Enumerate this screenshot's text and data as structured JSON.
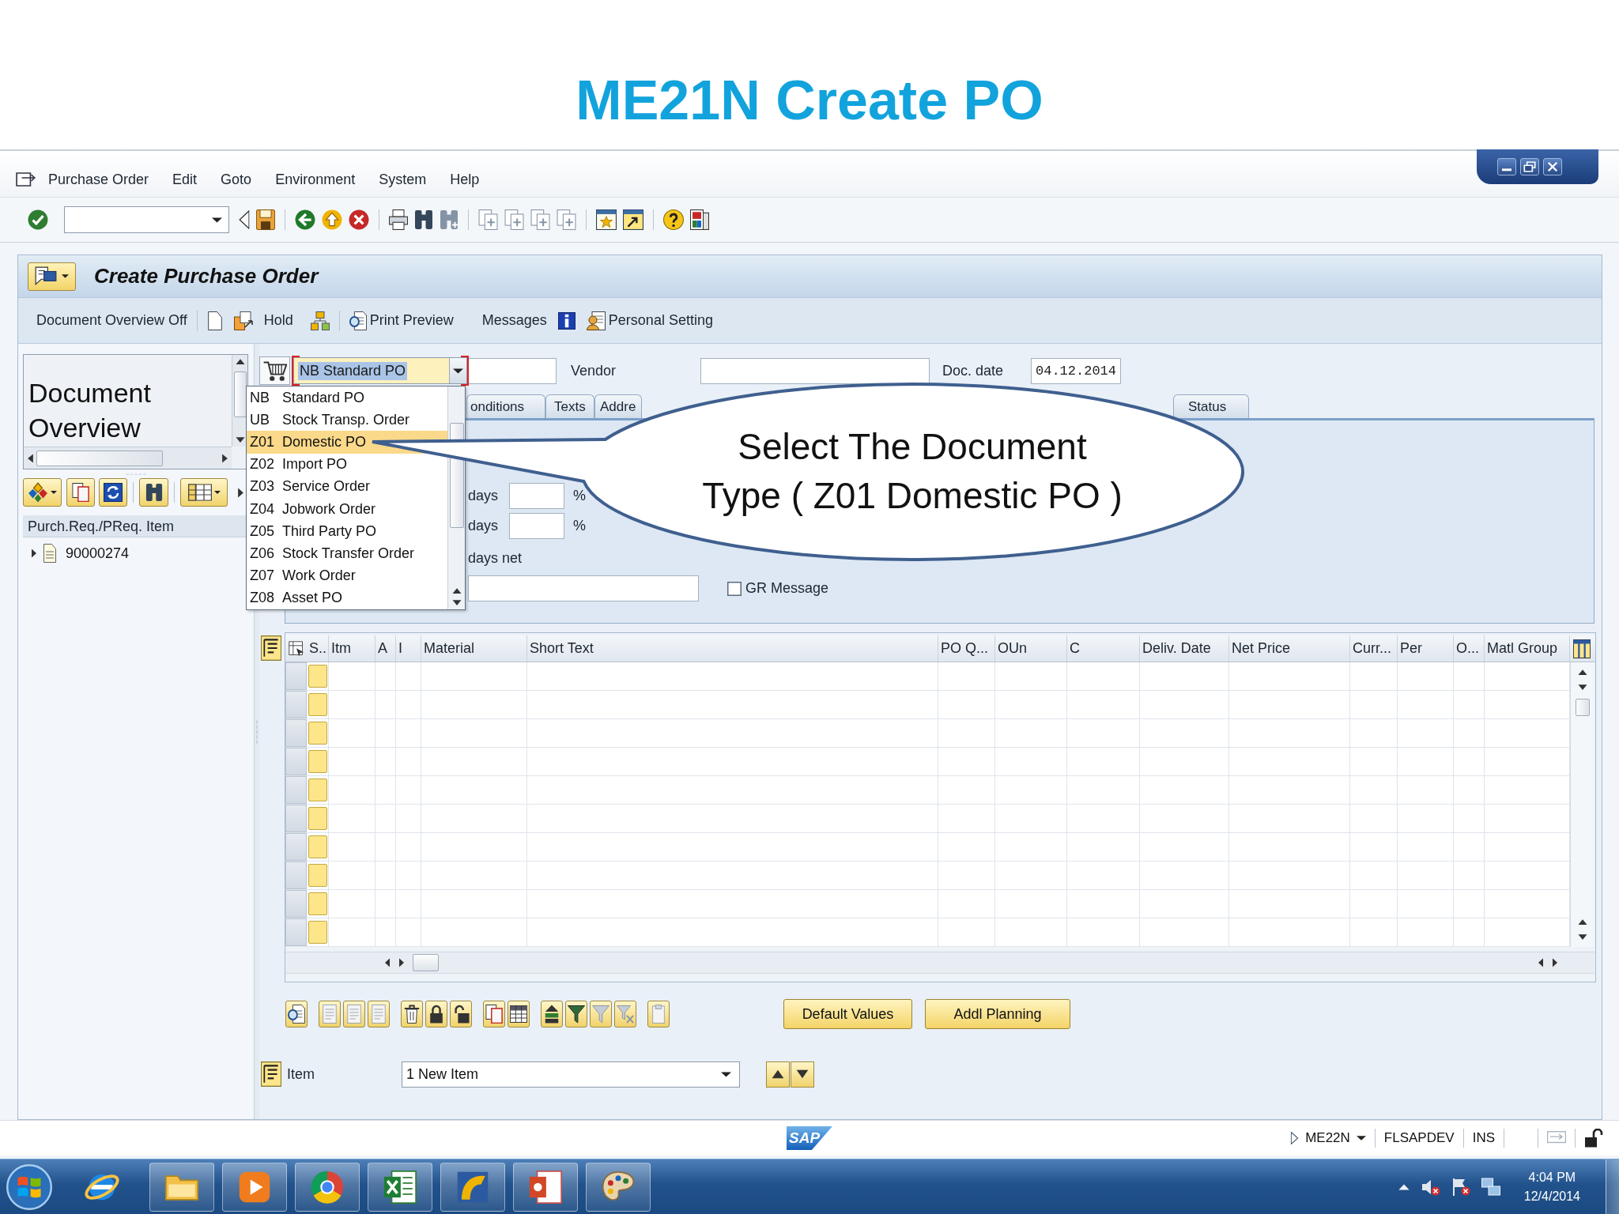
{
  "slide": {
    "title": "ME21N Create PO"
  },
  "menu_bar": [
    "Purchase Order",
    "Edit",
    "Goto",
    "Environment",
    "System",
    "Help"
  ],
  "title_bar": {
    "title": "Create Purchase Order"
  },
  "app_toolbar": {
    "document_overview_off": "Document Overview Off",
    "hold": "Hold",
    "print_preview": "Print Preview",
    "messages": "Messages",
    "personal_setting": "Personal Setting"
  },
  "document_overview": {
    "title": "Document Overview",
    "column_header": "Purch.Req./PReq. Item",
    "tree": [
      {
        "label": "90000274",
        "expanded": false
      }
    ]
  },
  "header": {
    "doc_type": {
      "value": "NB Standard PO",
      "open": true
    },
    "vendor_label": "Vendor",
    "doc_date_label": "Doc. date",
    "doc_date": "04.12.2014"
  },
  "doc_type_options": [
    {
      "code": "NB",
      "label": "Standard PO",
      "selected": false
    },
    {
      "code": "UB",
      "label": "Stock Transp. Order",
      "selected": false
    },
    {
      "code": "Z01",
      "label": "Domestic PO",
      "selected": true
    },
    {
      "code": "Z02",
      "label": "Import PO",
      "selected": false
    },
    {
      "code": "Z03",
      "label": "Service Order",
      "selected": false
    },
    {
      "code": "Z04",
      "label": "Jobwork Order",
      "selected": false
    },
    {
      "code": "Z05",
      "label": "Third Party PO",
      "selected": false
    },
    {
      "code": "Z06",
      "label": "Stock Transfer Order",
      "selected": false
    },
    {
      "code": "Z07",
      "label": "Work Order",
      "selected": false
    },
    {
      "code": "Z08",
      "label": "Asset PO",
      "selected": false
    }
  ],
  "tabs": [
    {
      "label": "onditions",
      "selected": false
    },
    {
      "label": "Texts",
      "selected": false
    },
    {
      "label": "Addre",
      "selected": false
    },
    {
      "label": "Status",
      "selected": false
    }
  ],
  "tab_panel": {
    "day_rows": [
      {
        "label": "days",
        "unit": "%"
      },
      {
        "label": "days",
        "unit": "%"
      }
    ],
    "net_label": "days net",
    "gr_message": {
      "label": "GR Message",
      "checked": false
    }
  },
  "items_table": {
    "columns": [
      "S..",
      "Itm",
      "A",
      "I",
      "Material",
      "Short Text",
      "PO Q...",
      "OUn",
      "C",
      "Deliv. Date",
      "Net Price",
      "Curr...",
      "Per",
      "O...",
      "Matl Group"
    ],
    "rows": [
      {
        "selected": false
      },
      {
        "selected": false
      },
      {
        "selected": false
      },
      {
        "selected": false
      },
      {
        "selected": false
      },
      {
        "selected": false
      },
      {
        "selected": false
      },
      {
        "selected": false
      },
      {
        "selected": false
      },
      {
        "selected": false
      }
    ]
  },
  "item_actions": [
    "Default Values",
    "Addl Planning"
  ],
  "item_selector": {
    "label": "Item",
    "value": "1 New Item"
  },
  "callout": {
    "lines": [
      "Select The Document",
      "Type ( Z01 Domestic PO )"
    ]
  },
  "status_bar": {
    "logo": "SAP",
    "transaction": "ME22N",
    "system": "FLSAPDEV",
    "mode": "INS"
  },
  "taskbar": {
    "time": "4:04 PM",
    "date": "12/4/2014"
  }
}
